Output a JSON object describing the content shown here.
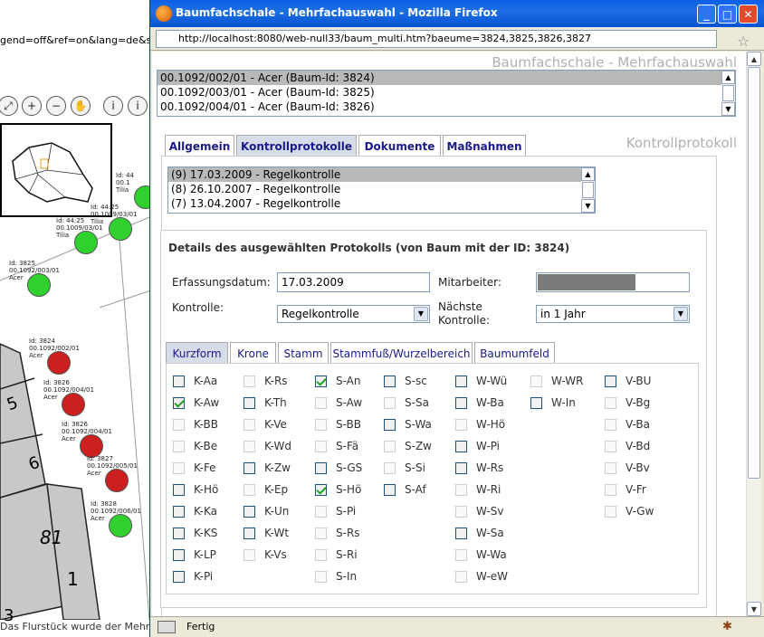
{
  "background_window": {
    "url_fragment": "gend=off&ref=on&lang=de&size=",
    "status_text": "Das Flurstück wurde der Mehr",
    "tools": [
      "zoom-extent-icon",
      "zoom-in-icon",
      "zoom-out-icon",
      "pan-hand-icon",
      "info-icon",
      "info-multi-icon"
    ],
    "parcels": [
      "5",
      "6",
      "81",
      "1",
      "3"
    ],
    "trees": [
      {
        "label": "Id: 44\n00.1\nTilia",
        "color": "#2fd12f"
      },
      {
        "label": "Id: 44:25\n00.1009/03/01\nTilia",
        "color": "#2fd12f"
      },
      {
        "label": "Id: 44:25\n00.1009/03/01\nTilia",
        "color": "#2fd12f"
      },
      {
        "label": "Id: 3825\n00.1092/003/01\nAcer",
        "color": "#2fd12f"
      },
      {
        "label": "Id: 3824\n00.1092/002/01\nAcer",
        "color": "#cc2020"
      },
      {
        "label": "Id: 3826\n00.1092/004/01\nAcer",
        "color": "#cc2020"
      },
      {
        "label": "Id: 3826\n00.1092/004/01\nAcer",
        "color": "#cc2020"
      },
      {
        "label": "Id: 3827\n00.1092/005/01\nAcer",
        "color": "#cc2020"
      },
      {
        "label": "Id: 3828\n00.1092/006/01\nAcer",
        "color": "#2fd12f"
      }
    ]
  },
  "window": {
    "title": "Baumfachschale - Mehrfachauswahl - Mozilla Firefox",
    "url": "http://localhost:8080/web-null33/baum_multi.htm?baeume=3824,3825,3826,3827",
    "status": "Fertig"
  },
  "page": {
    "title": "Baumfachschale - Mehrfachauswahl",
    "trees": [
      {
        "label": "00.1092/002/01 - Acer  (Baum-Id: 3824)",
        "selected": true
      },
      {
        "label": "00.1092/003/01 - Acer  (Baum-Id: 3825)",
        "selected": false
      },
      {
        "label": "00.1092/004/01 - Acer  (Baum-Id: 3826)",
        "selected": false
      }
    ],
    "main_tabs": [
      "Allgemein",
      "Kontrollprotokolle",
      "Dokumente",
      "Maßnahmen"
    ],
    "active_main_tab": "Kontrollprotokolle",
    "section_title": "Kontrollprotokoll",
    "protocols": [
      {
        "label": "(9) 17.03.2009 - Regelkontrolle",
        "selected": true
      },
      {
        "label": "(8) 26.10.2007 - Regelkontrolle",
        "selected": false
      },
      {
        "label": "(7) 13.04.2007 - Regelkontrolle",
        "selected": false
      }
    ],
    "details": {
      "title": "Details des ausgewählten Protokolls (von Baum mit der ID: 3824)",
      "erfassungsdatum_label": "Erfassungsdatum:",
      "erfassungsdatum_value": "17.03.2009",
      "mitarbeiter_label": "Mitarbeiter:",
      "kontrolle_label": "Kontrolle:",
      "kontrolle_value": "Regelkontrolle",
      "naechste_label_1": "Nächste",
      "naechste_label_2": "Kontrolle:",
      "naechste_value": "in 1 Jahr"
    },
    "sub_tabs": [
      "Kurzform",
      "Krone",
      "Stamm",
      "Stammfuß/Wurzelbereich",
      "Baumumfeld"
    ],
    "active_sub_tab": "Kurzform",
    "checkbox_columns": [
      [
        {
          "label": "K-Aa",
          "checked": false,
          "enabled": true
        },
        {
          "label": "K-Aw",
          "checked": true,
          "enabled": true
        },
        {
          "label": "K-BB",
          "checked": false,
          "enabled": false
        },
        {
          "label": "K-Be",
          "checked": false,
          "enabled": false
        },
        {
          "label": "K-Fe",
          "checked": false,
          "enabled": false
        },
        {
          "label": "K-Hö",
          "checked": false,
          "enabled": true
        },
        {
          "label": "K-Ka",
          "checked": false,
          "enabled": true
        },
        {
          "label": "K-KS",
          "checked": false,
          "enabled": true
        },
        {
          "label": "K-LP",
          "checked": false,
          "enabled": true
        },
        {
          "label": "K-Pi",
          "checked": false,
          "enabled": true
        }
      ],
      [
        {
          "label": "K-Rs",
          "checked": false,
          "enabled": false
        },
        {
          "label": "K-Th",
          "checked": false,
          "enabled": true
        },
        {
          "label": "K-Ve",
          "checked": false,
          "enabled": false
        },
        {
          "label": "K-Wd",
          "checked": false,
          "enabled": false
        },
        {
          "label": "K-Zw",
          "checked": false,
          "enabled": true
        },
        {
          "label": "K-Ep",
          "checked": false,
          "enabled": false
        },
        {
          "label": "K-Un",
          "checked": false,
          "enabled": true
        },
        {
          "label": "K-Wt",
          "checked": false,
          "enabled": true
        },
        {
          "label": "K-Vs",
          "checked": false,
          "enabled": false
        }
      ],
      [
        {
          "label": "S-An",
          "checked": true,
          "enabled": true
        },
        {
          "label": "S-Aw",
          "checked": false,
          "enabled": false
        },
        {
          "label": "S-BB",
          "checked": false,
          "enabled": false
        },
        {
          "label": "S-Fä",
          "checked": false,
          "enabled": false
        },
        {
          "label": "S-GS",
          "checked": false,
          "enabled": true
        },
        {
          "label": "S-Hö",
          "checked": true,
          "enabled": true
        },
        {
          "label": "S-Pi",
          "checked": false,
          "enabled": false
        },
        {
          "label": "S-Rs",
          "checked": false,
          "enabled": false
        },
        {
          "label": "S-Ri",
          "checked": false,
          "enabled": false
        },
        {
          "label": "S-In",
          "checked": false,
          "enabled": false
        }
      ],
      [
        {
          "label": "S-sc",
          "checked": false,
          "enabled": true
        },
        {
          "label": "S-Sa",
          "checked": false,
          "enabled": false
        },
        {
          "label": "S-Wa",
          "checked": false,
          "enabled": true
        },
        {
          "label": "S-Zw",
          "checked": false,
          "enabled": false
        },
        {
          "label": "S-Si",
          "checked": false,
          "enabled": false
        },
        {
          "label": "S-Af",
          "checked": false,
          "enabled": true
        }
      ],
      [
        {
          "label": "W-Wü",
          "checked": false,
          "enabled": true
        },
        {
          "label": "W-Ba",
          "checked": false,
          "enabled": true
        },
        {
          "label": "W-Hö",
          "checked": false,
          "enabled": false
        },
        {
          "label": "W-Pi",
          "checked": false,
          "enabled": true
        },
        {
          "label": "W-Rs",
          "checked": false,
          "enabled": true
        },
        {
          "label": "W-Ri",
          "checked": false,
          "enabled": false
        },
        {
          "label": "W-Sv",
          "checked": false,
          "enabled": false
        },
        {
          "label": "W-Sa",
          "checked": false,
          "enabled": true
        },
        {
          "label": "W-Wa",
          "checked": false,
          "enabled": false
        },
        {
          "label": "W-eW",
          "checked": false,
          "enabled": false
        }
      ],
      [
        {
          "label": "W-WR",
          "checked": false,
          "enabled": false
        },
        {
          "label": "W-In",
          "checked": false,
          "enabled": true
        }
      ],
      [
        {
          "label": "V-BU",
          "checked": false,
          "enabled": true
        },
        {
          "label": "V-Bg",
          "checked": false,
          "enabled": false
        },
        {
          "label": "V-Ba",
          "checked": false,
          "enabled": false
        },
        {
          "label": "V-Bd",
          "checked": false,
          "enabled": false
        },
        {
          "label": "V-Bv",
          "checked": false,
          "enabled": false
        },
        {
          "label": "V-Fr",
          "checked": false,
          "enabled": false
        },
        {
          "label": "V-Gw",
          "checked": false,
          "enabled": false
        }
      ]
    ]
  }
}
